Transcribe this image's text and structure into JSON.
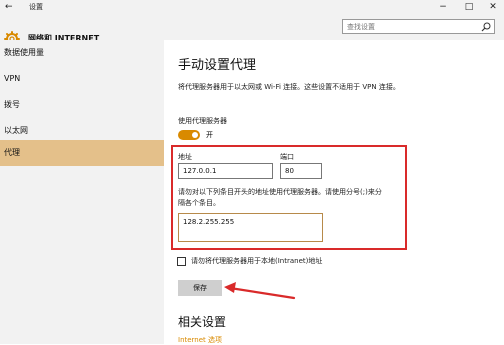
{
  "window": {
    "title": "设置",
    "back_glyph": "←",
    "minimize_glyph": "−",
    "maximize_glyph": "□",
    "close_glyph": "✕"
  },
  "header": {
    "title": "网络和 INTERNET",
    "icon": "gear-icon",
    "search_placeholder": "查找设置"
  },
  "sidebar": {
    "items": [
      {
        "label": "数据使用量"
      },
      {
        "label": "VPN"
      },
      {
        "label": "拨号"
      },
      {
        "label": "以太网"
      },
      {
        "label": "代理",
        "selected": true
      }
    ]
  },
  "main": {
    "title": "手动设置代理",
    "description": "将代理服务器用于以太网或 Wi-Fi 连接。这些设置不适用于 VPN 连接。",
    "use_proxy_label": "使用代理服务器",
    "toggle_state": "开",
    "address_label": "地址",
    "address_value": "127.0.0.1",
    "port_label": "端口",
    "port_value": "80",
    "exceptions_label_line1": "请勿对以下列条目开头的地址使用代理服务器。请使用分号(;)来分",
    "exceptions_label_line2": "隔各个条目。",
    "exceptions_value": "128.2.255.255",
    "local_checkbox_label": "请勿将代理服务器用于本地(Intranet)地址",
    "save_label": "保存",
    "related_title": "相关设置",
    "related_link": "Internet 选项"
  },
  "colors": {
    "accent": "#d98a00",
    "selected_nav": "#e4c08a",
    "annotation_red": "#d92a2a"
  }
}
